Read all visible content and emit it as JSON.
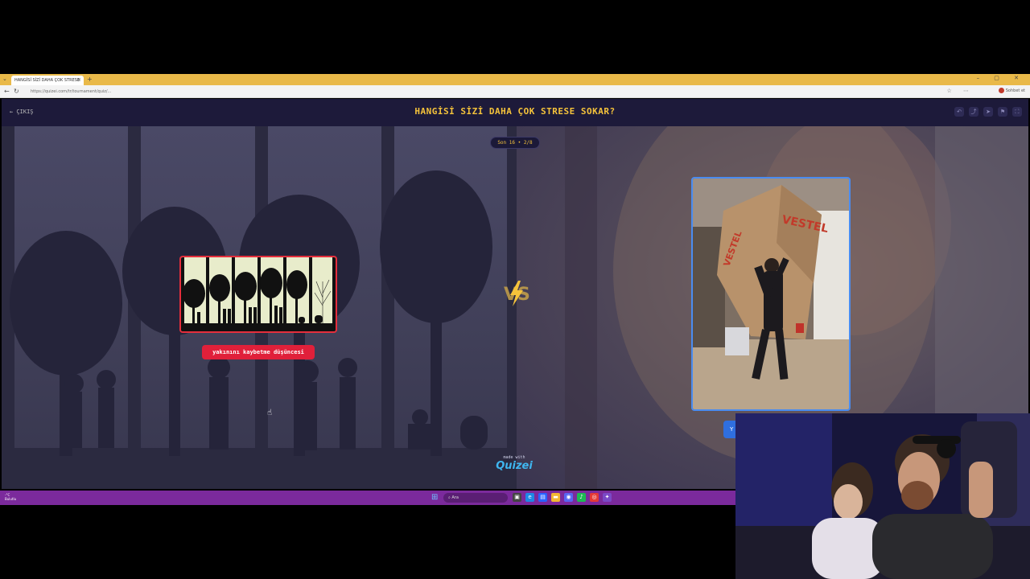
{
  "browser": {
    "tab_title": "HANGİSİ SİZİ DAHA ÇOK STRESE",
    "tab_close": "×",
    "new_tab": "+",
    "url": "https://quizei.com/tr/tournament/quiz/...",
    "profile_label": "Sohbet et",
    "window_controls": "– ▢ ✕"
  },
  "app": {
    "exit_label": "← ÇIKIŞ",
    "title": "HANGİSİ SİZİ DAHA ÇOK STRESE SOKAR?",
    "round_badge": "Son 16 • 2/8",
    "header_icons": [
      "undo-icon",
      "share-icon",
      "send-icon",
      "flag-icon",
      "fullscreen-icon"
    ]
  },
  "match": {
    "left_label": "yakınını kaybetme düşüncesi",
    "vs_text": "VS",
    "next_label": "Y",
    "made_with_top": "made with",
    "made_with_brand": "Quizei"
  },
  "taskbar": {
    "weather_temp": "-°C",
    "weather_desc": "Bulutlu",
    "search_placeholder": "Ara"
  },
  "colors": {
    "accent_yellow": "#f5c33b",
    "left_border": "#e52e3c",
    "right_border": "#4a8cf0",
    "header_bg": "#1d1a3a",
    "taskbar_bg": "#7b2a9c"
  }
}
